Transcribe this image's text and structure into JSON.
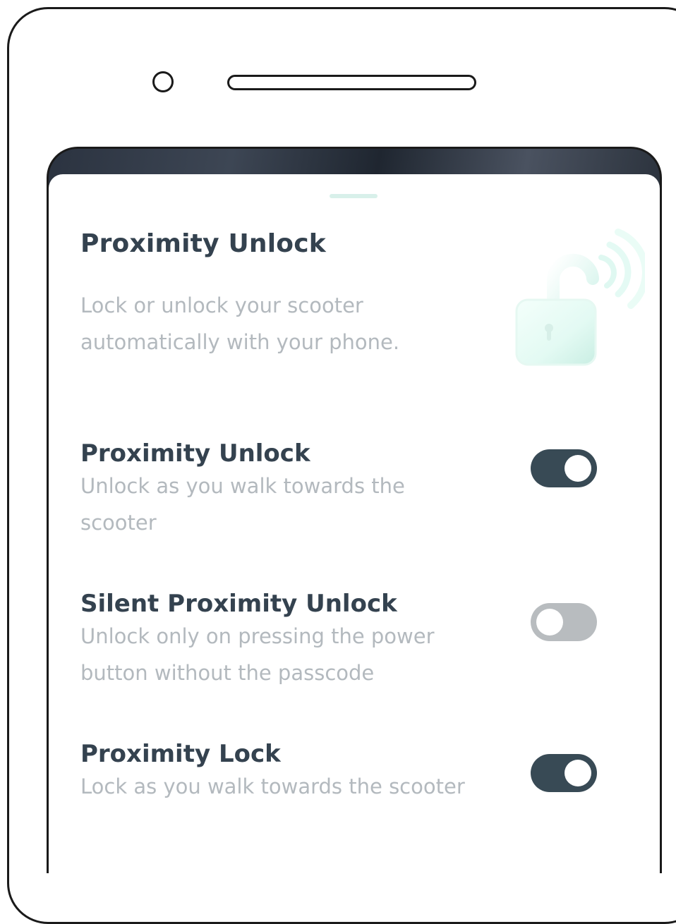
{
  "header": {
    "title": "Proximity Unlock",
    "description": "Lock or unlock your scooter automatically with your phone."
  },
  "settings": [
    {
      "title": "Proximity Unlock",
      "description": "Unlock as you walk towards the scooter",
      "enabled": true
    },
    {
      "title": "Silent Proximity Unlock",
      "description": "Unlock only on pressing the power button without the passcode",
      "enabled": false
    },
    {
      "title": "Proximity Lock",
      "description": "Lock as you walk towards the scooter",
      "enabled": true
    }
  ],
  "icons": {
    "camera": "camera-icon",
    "speaker": "speaker-slot",
    "lock": "unlocked-padlock-wireless-icon"
  },
  "colors": {
    "toggle_on": "#384a55",
    "toggle_off": "#b8bcbf",
    "title_text": "#34424f",
    "description_text": "#b3b9be",
    "lock_accent": "#d7f7ef"
  }
}
